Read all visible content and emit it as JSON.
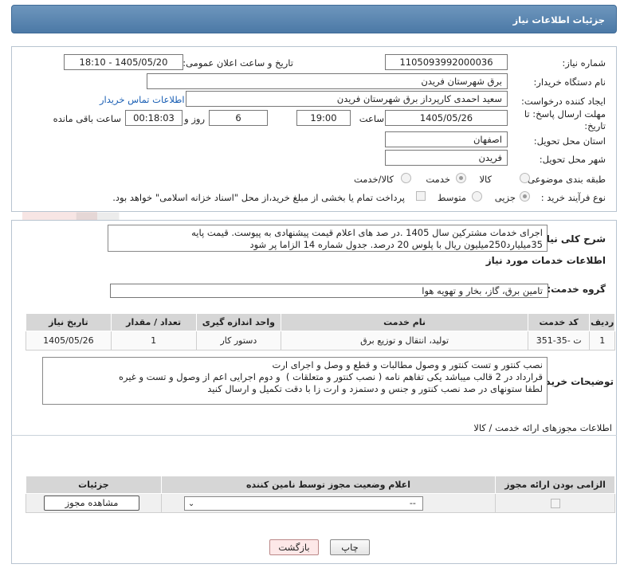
{
  "header": {
    "title": "جزئیات اطلاعات نیاز"
  },
  "form": {
    "need_number_label": "شماره نیاز:",
    "need_number": "1105093992000036",
    "announce_label": "تاریخ و ساعت اعلان عمومی:",
    "announce_value": "1405/05/20 - 18:10",
    "buyer_org_label": "نام دستگاه خریدار:",
    "buyer_org": "برق شهرستان فریدن",
    "creator_label": "ایجاد کننده درخواست:",
    "creator": "سعید احمدی کارپرداز برق شهرستان فریدن",
    "contact_link": "اطلاعات تماس خریدار",
    "deadline_label_1": "مهلت ارسال پاسخ: تا",
    "deadline_label_2": "تاریخ:",
    "deadline_date": "1405/05/26",
    "time_label": "ساعت",
    "deadline_time": "19:00",
    "days_value": "6",
    "days_label": "روز و",
    "remaining_time": "00:18:03",
    "remaining_label": "ساعت باقی مانده",
    "province_label": "استان محل تحویل:",
    "province": "اصفهان",
    "city_label": "شهر محل تحویل:",
    "city": "فریدن",
    "category_label": "طبقه بندی موضوعی:",
    "category_options": [
      "کالا",
      "خدمت",
      "کالا/خدمت"
    ],
    "category_selected": "خدمت",
    "process_label": "نوع فرآیند خرید :",
    "process_options": [
      "جزیی",
      "متوسط"
    ],
    "process_selected": "جزیی",
    "payment_note": "پرداخت تمام یا بخشی از مبلغ خرید،از محل \"اسناد خزانه اسلامی\" خواهد بود."
  },
  "summary": {
    "label": "شرح کلی نیاز:",
    "line1": "اجرای خدمات مشترکین سال 1405 .در صد های اعلام قیمت پیشنهادی به پیوست. قیمت پایه",
    "line2": "35میلیارد250میلیون ریال با پلوس 20 درصد. جدول شماره 14 الزاما پر شود"
  },
  "services": {
    "section_title": "اطلاعات خدمات مورد نیاز",
    "group_label": "گروه خدمت:",
    "group_value": "تامین برق، گاز، بخار و تهویه هوا",
    "columns": [
      "ردیف",
      "کد خدمت",
      "نام خدمت",
      "واحد اندازه گیری",
      "تعداد / مقدار",
      "تاریخ نیاز"
    ],
    "rows": [
      [
        "1",
        "ت -35-351",
        "تولید، انتقال و توزیع برق",
        "دستور کار",
        "1",
        "1405/05/26"
      ]
    ]
  },
  "buyer_notes": {
    "label": "توضیحات خریدار:",
    "line1": "نصب کنتور و تست کنتور و وصول مطالبات و قطع و وصل و اجرای ارت",
    "line2": "قرارداد در 2 قالب میباشد یکی تفاهم نامه ( نصب کنتور و متعلقات )  و دوم اجرایی اعم از وصول و تست و غیره",
    "line3": "لطفا ستونهای در صد نصب کنتور و جنس و دستمزد و ارت زا با دقت تکمیل و ارسال کنید"
  },
  "permits": {
    "section_title": "اطلاعات مجوزهای ارائه خدمت / کالا",
    "columns": [
      "الزامی بودن ارائه مجوز",
      "اعلام وضعیت مجوز توسط نامین کننده",
      "جزئیات"
    ],
    "select_value": "--",
    "view_button": "مشاهده مجوز"
  },
  "buttons": {
    "print": "چاپ",
    "back": "بازگشت"
  },
  "watermark_text": "AriaTender.neT"
}
